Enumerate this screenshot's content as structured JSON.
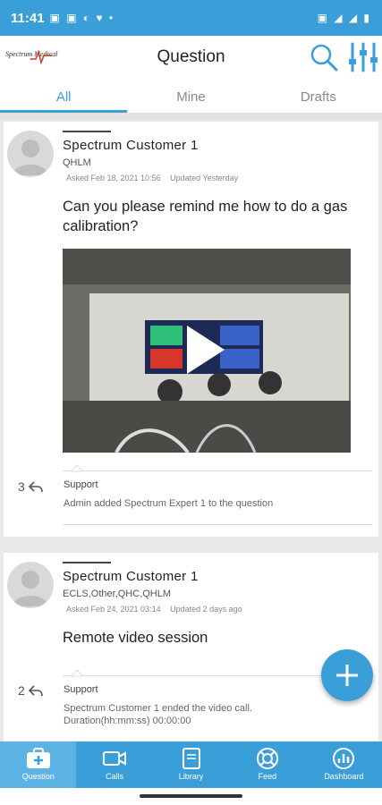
{
  "status_bar": {
    "time": "11:41",
    "left_icons": "▣ ▣ ◐ ♥ •",
    "right_icons": "▣ ◢ ◢ ▮"
  },
  "app_bar": {
    "logo_text": "Spectrum Medical",
    "title": "Question"
  },
  "tabs": [
    {
      "label": "All",
      "active": true
    },
    {
      "label": "Mine",
      "active": false
    },
    {
      "label": "Drafts",
      "active": false
    }
  ],
  "questions": [
    {
      "user": "Spectrum Customer 1",
      "tags": "QHLM",
      "asked": "Asked Feb 18, 2021 10:56",
      "updated": "Updated Yesterday",
      "text": "Can you please remind me how to do a gas calibration?",
      "has_video": true,
      "answer_count": "3",
      "activity_author": "Support",
      "activity_text": "Admin added Spectrum Expert 1 to the question"
    },
    {
      "user": "Spectrum Customer 1",
      "tags": "ECLS,Other,QHC,QHLM",
      "asked": "Asked Feb 24, 2021 03:14",
      "updated": "Updated 2 days ago",
      "text": "Remote video session",
      "has_video": false,
      "answer_count": "2",
      "activity_author": "Support",
      "activity_text": "Spectrum Customer 1 ended the video call. Duration(hh:mm:ss) 00:00:00"
    }
  ],
  "bottom_nav": [
    {
      "label": "Question",
      "icon": "add-question-icon",
      "active": true
    },
    {
      "label": "Calls",
      "icon": "video-camera-icon",
      "active": false
    },
    {
      "label": "Library",
      "icon": "book-icon",
      "active": false
    },
    {
      "label": "Feed",
      "icon": "lifebuoy-icon",
      "active": false
    },
    {
      "label": "Dashboard",
      "icon": "chart-icon",
      "active": false
    }
  ],
  "colors": {
    "accent": "#3a9fd8",
    "nav_active": "#5db3e3"
  }
}
